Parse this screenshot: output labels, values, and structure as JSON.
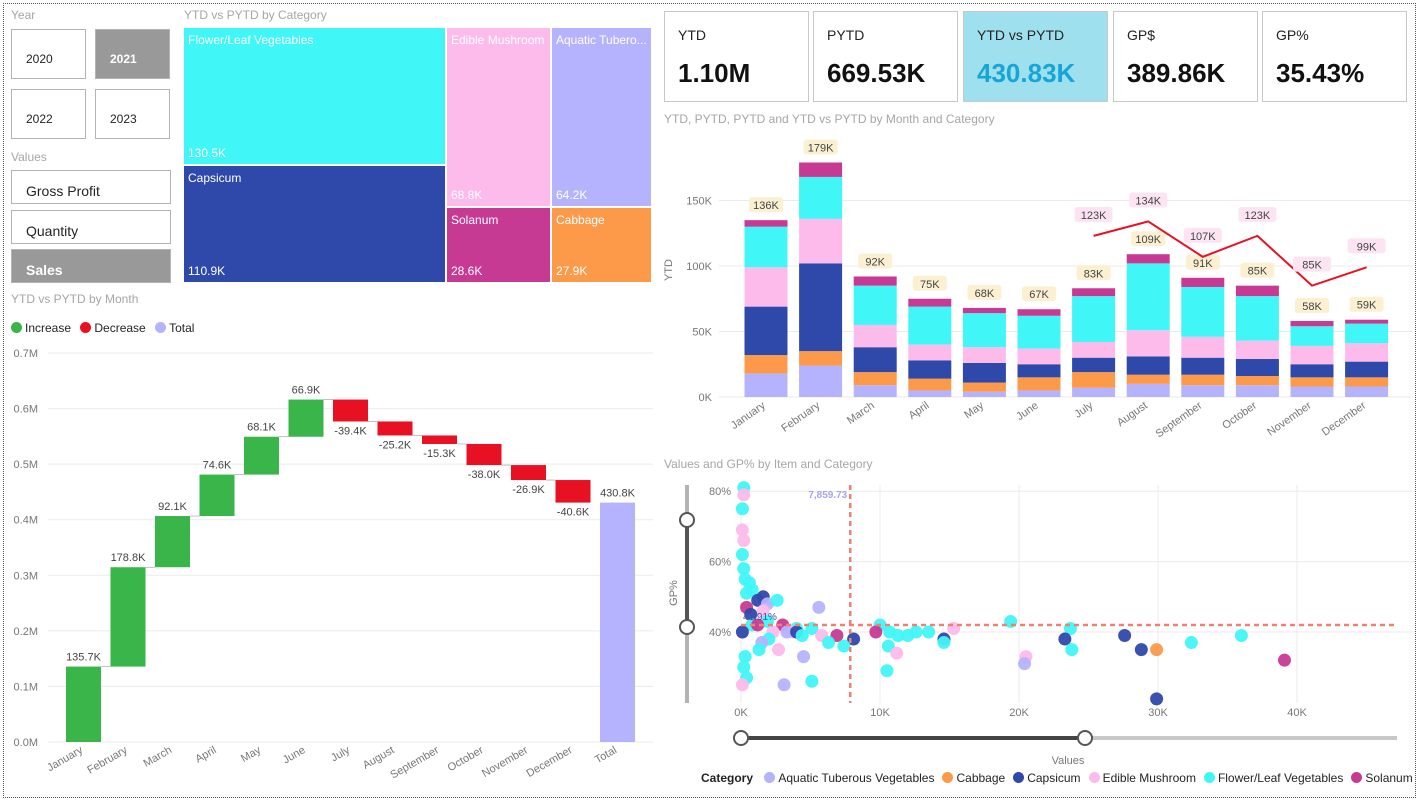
{
  "slicer_year": {
    "title": "Year",
    "options": [
      {
        "label": "2020",
        "selected": false
      },
      {
        "label": "2021",
        "selected": true
      },
      {
        "label": "2022",
        "selected": false
      },
      {
        "label": "2023",
        "selected": false
      }
    ]
  },
  "slicer_values": {
    "title": "Values",
    "options": [
      {
        "label": "Gross Profit",
        "selected": false
      },
      {
        "label": "Quantity",
        "selected": false
      },
      {
        "label": "Sales",
        "selected": true
      }
    ]
  },
  "treemap": {
    "title": "YTD vs PYTD by Category",
    "tiles": [
      {
        "name": "Flower/Leaf Vegetables",
        "value": "130.5K",
        "color": "#41f6f7"
      },
      {
        "name": "Capsicum",
        "value": "110.9K",
        "color": "#2f49ab"
      },
      {
        "name": "Edible Mushroom",
        "value": "68.8K",
        "color": "#fdbbeb"
      },
      {
        "name": "Aquatic Tubero...",
        "value": "64.2K",
        "color": "#b5b3fd"
      },
      {
        "name": "Solanum",
        "value": "28.6K",
        "color": "#c73a94"
      },
      {
        "name": "Cabbage",
        "value": "27.9K",
        "color": "#fd9a4a"
      }
    ]
  },
  "kpi_cards": [
    {
      "title": "YTD",
      "value": "1.10M",
      "selected": false
    },
    {
      "title": "PYTD",
      "value": "669.53K",
      "selected": false
    },
    {
      "title": "YTD vs PYTD",
      "value": "430.83K",
      "selected": true
    },
    {
      "title": "GP$",
      "value": "389.86K",
      "selected": false
    },
    {
      "title": "GP%",
      "value": "35.43%",
      "selected": false
    }
  ],
  "colors": {
    "aquatic": "#b5b3fd",
    "cabbage": "#fd9a4a",
    "capsicum": "#2f49ab",
    "mushroom": "#fdbbeb",
    "flower": "#41f6f7",
    "solanum": "#c73a94",
    "increase": "#3ab54a",
    "decrease": "#e81123",
    "total": "#b5b3fd",
    "ytd_vs_pytd_line": "#e81123"
  },
  "chart_data": [
    {
      "type": "waterfall",
      "title": "YTD vs PYTD by Month",
      "legend": [
        "Increase",
        "Decrease",
        "Total"
      ],
      "legend_position": "top-left",
      "categories": [
        "January",
        "February",
        "March",
        "April",
        "May",
        "June",
        "July",
        "August",
        "September",
        "October",
        "November",
        "December",
        "Total"
      ],
      "values": [
        135.7,
        178.8,
        92.1,
        74.6,
        68.1,
        66.9,
        -39.4,
        -25.2,
        -15.3,
        -38.0,
        -26.9,
        -40.6,
        430.8
      ],
      "labels": [
        "135.7K",
        "178.8K",
        "92.1K",
        "74.6K",
        "68.1K",
        "66.9K",
        "-39.4K",
        "-25.2K",
        "-15.3K",
        "-38.0K",
        "-26.9K",
        "-40.6K",
        "430.8K"
      ],
      "units": "K",
      "ylim": [
        0,
        0.7
      ],
      "y_ticks": [
        "0.0M",
        "0.1M",
        "0.2M",
        "0.3M",
        "0.4M",
        "0.5M",
        "0.6M",
        "0.7M"
      ],
      "grid": true
    },
    {
      "type": "bar",
      "stacked": true,
      "title": "YTD, PYTD, PYTD and YTD vs PYTD by Month and Category",
      "ylabel": "YTD",
      "ylim": [
        0,
        180
      ],
      "y_ticks": [
        "0K",
        "50K",
        "100K",
        "150K"
      ],
      "categories": [
        "January",
        "February",
        "March",
        "April",
        "May",
        "June",
        "July",
        "August",
        "September",
        "October",
        "November",
        "December"
      ],
      "series": [
        {
          "key": "aquatic",
          "values": [
            18,
            24,
            9,
            5,
            4,
            5,
            7,
            10,
            9,
            9,
            8,
            8
          ]
        },
        {
          "key": "cabbage",
          "values": [
            14,
            11,
            10,
            9,
            7,
            10,
            12,
            7,
            8,
            7,
            7,
            7
          ]
        },
        {
          "key": "capsicum",
          "values": [
            37,
            67,
            19,
            14,
            15,
            10,
            11,
            14,
            13,
            13,
            10,
            12
          ]
        },
        {
          "key": "mushroom",
          "values": [
            30,
            34,
            17,
            12,
            12,
            12,
            12,
            20,
            16,
            14,
            14,
            14
          ]
        },
        {
          "key": "flower",
          "values": [
            31,
            32,
            30,
            29,
            26,
            25,
            35,
            51,
            38,
            34,
            15,
            15
          ]
        },
        {
          "key": "solanum",
          "values": [
            5,
            11,
            7,
            6,
            4,
            5,
            6,
            7,
            7,
            8,
            4,
            3
          ]
        }
      ],
      "totals_labels": [
        "136K",
        "179K",
        "92K",
        "75K",
        "68K",
        "67K",
        "83K",
        "109K",
        "91K",
        "85K",
        "58K",
        "59K"
      ],
      "line": {
        "name": "YTD vs PYTD",
        "categories": [
          "July",
          "August",
          "September",
          "October",
          "November",
          "December"
        ],
        "values": [
          123,
          134,
          107,
          123,
          85,
          99
        ],
        "labels": [
          "123K",
          "134K",
          "107K",
          "123K",
          "85K",
          "99K"
        ]
      }
    },
    {
      "type": "scatter",
      "title": "Values and GP% by Item and Category",
      "xlabel": "Values",
      "ylabel": "GP%",
      "x_ticks": [
        "0K",
        "10K",
        "20K",
        "30K",
        "40K"
      ],
      "y_ticks": [
        "40%",
        "60%",
        "80%"
      ],
      "xlim": [
        0,
        47
      ],
      "ylim": [
        23,
        82
      ],
      "reference_x": {
        "value": 7.86,
        "label": "7,859.73"
      },
      "reference_y": {
        "value": 42,
        "label": "41.91%"
      },
      "legend_title": "Category",
      "legend": [
        {
          "key": "aquatic",
          "name": "Aquatic Tuberous Vegetables"
        },
        {
          "key": "cabbage",
          "name": "Cabbage"
        },
        {
          "key": "capsicum",
          "name": "Capsicum"
        },
        {
          "key": "mushroom",
          "name": "Edible Mushroom"
        },
        {
          "key": "flower",
          "name": "Flower/Leaf Vegetables"
        },
        {
          "key": "solanum",
          "name": "Solanum"
        }
      ],
      "points": [
        {
          "c": "flower",
          "x": 0.2,
          "y": 81
        },
        {
          "c": "mushroom",
          "x": 0.2,
          "y": 79
        },
        {
          "c": "flower",
          "x": 0.1,
          "y": 75
        },
        {
          "c": "mushroom",
          "x": 0.1,
          "y": 69
        },
        {
          "c": "mushroom",
          "x": 0.2,
          "y": 66
        },
        {
          "c": "flower",
          "x": 0.1,
          "y": 62
        },
        {
          "c": "flower",
          "x": 0.2,
          "y": 58
        },
        {
          "c": "flower",
          "x": 0.3,
          "y": 55
        },
        {
          "c": "flower",
          "x": 0.6,
          "y": 54
        },
        {
          "c": "flower",
          "x": 0.8,
          "y": 52
        },
        {
          "c": "flower",
          "x": 0.4,
          "y": 51
        },
        {
          "c": "capsicum",
          "x": 1.6,
          "y": 50
        },
        {
          "c": "capsicum",
          "x": 1.2,
          "y": 49
        },
        {
          "c": "aquatic",
          "x": 1.9,
          "y": 48
        },
        {
          "c": "flower",
          "x": 2.6,
          "y": 49
        },
        {
          "c": "aquatic",
          "x": 5.6,
          "y": 47
        },
        {
          "c": "solanum",
          "x": 0.4,
          "y": 47
        },
        {
          "c": "mushroom",
          "x": 1.6,
          "y": 46
        },
        {
          "c": "capsicum",
          "x": 0.7,
          "y": 45
        },
        {
          "c": "flower",
          "x": 1.9,
          "y": 43
        },
        {
          "c": "flower",
          "x": 0.8,
          "y": 42
        },
        {
          "c": "solanum",
          "x": 1.2,
          "y": 42
        },
        {
          "c": "solanum",
          "x": 3.0,
          "y": 42
        },
        {
          "c": "capsicum",
          "x": 0.1,
          "y": 40
        },
        {
          "c": "flower",
          "x": 4.0,
          "y": 41
        },
        {
          "c": "mushroom",
          "x": 3.7,
          "y": 40
        },
        {
          "c": "mushroom",
          "x": 2.3,
          "y": 40
        },
        {
          "c": "aquatic",
          "x": 3.3,
          "y": 40
        },
        {
          "c": "capsicum",
          "x": 4.0,
          "y": 40
        },
        {
          "c": "flower",
          "x": 5.1,
          "y": 41
        },
        {
          "c": "flower",
          "x": 4.4,
          "y": 39
        },
        {
          "c": "mushroom",
          "x": 5.8,
          "y": 39
        },
        {
          "c": "solanum",
          "x": 6.9,
          "y": 39
        },
        {
          "c": "capsicum",
          "x": 8.1,
          "y": 38
        },
        {
          "c": "flower",
          "x": 2.0,
          "y": 38
        },
        {
          "c": "aquatic",
          "x": 1.5,
          "y": 37
        },
        {
          "c": "flower",
          "x": 6.3,
          "y": 37
        },
        {
          "c": "flower",
          "x": 7.4,
          "y": 36
        },
        {
          "c": "mushroom",
          "x": 2.7,
          "y": 35
        },
        {
          "c": "flower",
          "x": 1.3,
          "y": 35
        },
        {
          "c": "aquatic",
          "x": 4.5,
          "y": 33
        },
        {
          "c": "flower",
          "x": 0.3,
          "y": 33
        },
        {
          "c": "flower",
          "x": 0.2,
          "y": 30
        },
        {
          "c": "flower",
          "x": 0.4,
          "y": 27
        },
        {
          "c": "mushroom",
          "x": 0.1,
          "y": 25
        },
        {
          "c": "flower",
          "x": 5.1,
          "y": 26
        },
        {
          "c": "aquatic",
          "x": 3.1,
          "y": 25
        },
        {
          "c": "flower",
          "x": 10.0,
          "y": 42
        },
        {
          "c": "solanum",
          "x": 9.7,
          "y": 40
        },
        {
          "c": "flower",
          "x": 10.7,
          "y": 40
        },
        {
          "c": "flower",
          "x": 11.3,
          "y": 39
        },
        {
          "c": "flower",
          "x": 12.0,
          "y": 39
        },
        {
          "c": "flower",
          "x": 12.6,
          "y": 40
        },
        {
          "c": "flower",
          "x": 13.5,
          "y": 40
        },
        {
          "c": "capsicum",
          "x": 14.6,
          "y": 38
        },
        {
          "c": "flower",
          "x": 14.6,
          "y": 37
        },
        {
          "c": "mushroom",
          "x": 15.3,
          "y": 41
        },
        {
          "c": "flower",
          "x": 10.6,
          "y": 36
        },
        {
          "c": "mushroom",
          "x": 11.2,
          "y": 34
        },
        {
          "c": "flower",
          "x": 10.5,
          "y": 29
        },
        {
          "c": "flower",
          "x": 19.4,
          "y": 43
        },
        {
          "c": "flower",
          "x": 23.7,
          "y": 41
        },
        {
          "c": "capsicum",
          "x": 23.3,
          "y": 38
        },
        {
          "c": "flower",
          "x": 23.8,
          "y": 35
        },
        {
          "c": "mushroom",
          "x": 20.5,
          "y": 33
        },
        {
          "c": "aquatic",
          "x": 20.4,
          "y": 31
        },
        {
          "c": "capsicum",
          "x": 27.6,
          "y": 39
        },
        {
          "c": "capsicum",
          "x": 28.8,
          "y": 35
        },
        {
          "c": "cabbage",
          "x": 29.9,
          "y": 35
        },
        {
          "c": "flower",
          "x": 32.4,
          "y": 37
        },
        {
          "c": "flower",
          "x": 36.0,
          "y": 39
        },
        {
          "c": "solanum",
          "x": 39.1,
          "y": 32
        },
        {
          "c": "capsicum",
          "x": 29.9,
          "y": 21
        }
      ]
    }
  ]
}
